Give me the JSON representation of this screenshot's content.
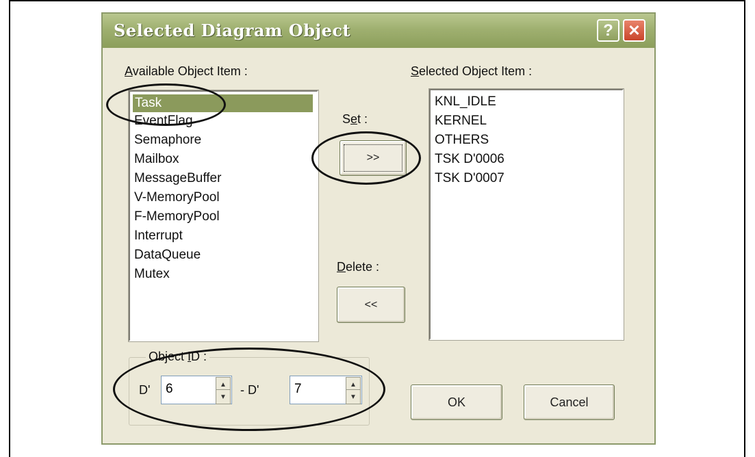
{
  "dialog": {
    "title": "Selected Diagram Object",
    "help_button": "?",
    "close_button": "✕"
  },
  "available": {
    "label_prefix": "",
    "label_accel": "A",
    "label_rest": "vailable Object Item :",
    "items": [
      "Task",
      "EventFlag",
      "Semaphore",
      "Mailbox",
      "MessageBuffer",
      "V-MemoryPool",
      "F-MemoryPool",
      "Interrupt",
      "DataQueue",
      "Mutex"
    ],
    "selected_index": 0
  },
  "set": {
    "label_prefix": "S",
    "label_accel": "e",
    "label_rest": "t :",
    "button": ">>"
  },
  "delete": {
    "label_prefix": "",
    "label_accel": "D",
    "label_rest": "elete :",
    "button": "<<"
  },
  "selected": {
    "label_prefix": "",
    "label_accel": "S",
    "label_rest": "elected Object Item :",
    "items": [
      "KNL_IDLE",
      "KERNEL",
      "OTHERS",
      "TSK D'0006",
      "TSK D'0007"
    ]
  },
  "object_id": {
    "legend_prefix": "Object ",
    "legend_accel": "I",
    "legend_rest": "D :",
    "from_prefix": "D'",
    "from_value": "6",
    "to_prefix": "- D'",
    "to_value": "7"
  },
  "actions": {
    "ok": "OK",
    "cancel": "Cancel"
  }
}
